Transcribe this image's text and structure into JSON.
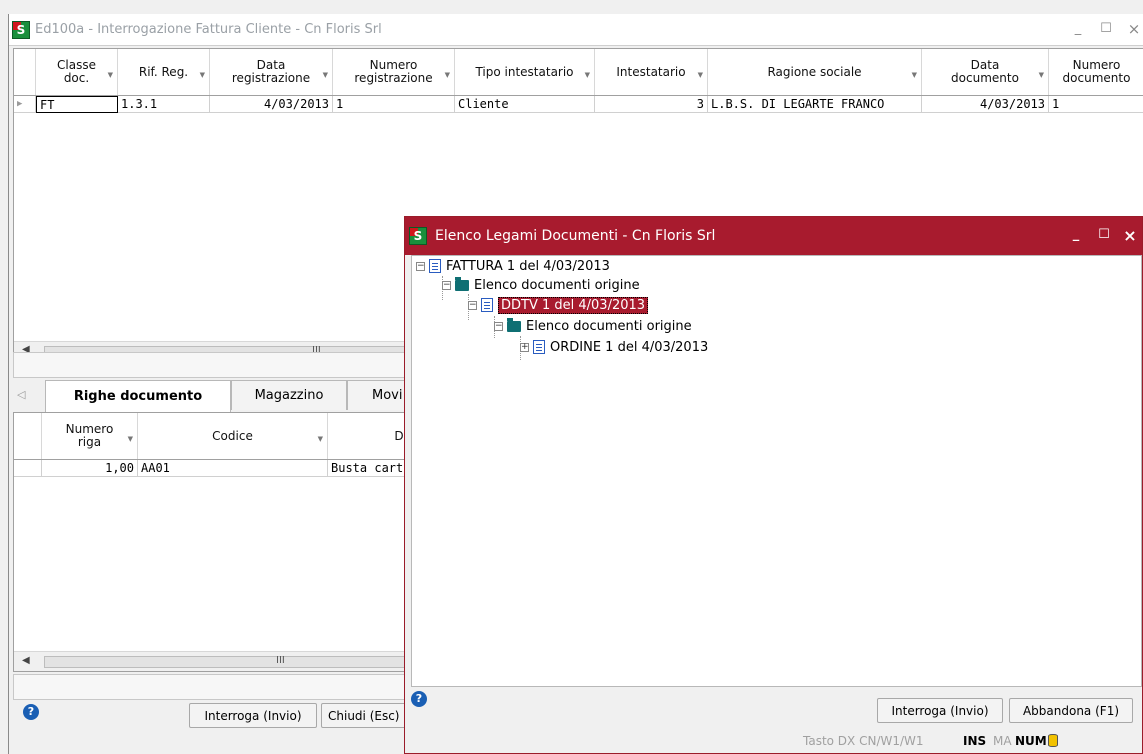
{
  "main_window": {
    "title": "Ed100a - Interrogazione Fattura Cliente - Cn Floris Srl",
    "logo_letter": "S",
    "minimize": "_",
    "maximize": "☐",
    "close": "×"
  },
  "documents_grid": {
    "columns": [
      "Classe doc.",
      "Rif. Reg.",
      "Data registrazione",
      "Numero registrazione",
      "Tipo intestatario",
      "Intestatario",
      "Ragione sociale",
      "Data documento",
      "Numero documento"
    ],
    "row": {
      "classe_doc": "FT",
      "rif_reg": "1.3.1",
      "data_registrazione": "4/03/2013",
      "numero_registrazione": "1",
      "tipo_intestatario": "Cliente",
      "intestatario": "3",
      "ragione_sociale": "L.B.S. DI LEGARTE FRANCO",
      "data_documento": "4/03/2013",
      "numero_documento": "1"
    },
    "scroll_grip": "III"
  },
  "tabs": [
    "Righe documento",
    "Magazzino",
    "Movi"
  ],
  "rows_grid": {
    "columns": [
      "Numero riga",
      "Codice",
      "De"
    ],
    "row": {
      "numero_riga": "1,00",
      "codice": "AA01",
      "descrizione": "Busta carta"
    },
    "scroll_grip": "III"
  },
  "main_buttons": {
    "query": "Interroga (Invio)",
    "close": "Chiudi (Esc)"
  },
  "dialog": {
    "title": "Elenco Legami Documenti - Cn Floris Srl",
    "logo_letter": "S",
    "minimize": "_",
    "maximize": "☐",
    "close": "×",
    "tree": {
      "root": "FATTURA 1 del  4/03/2013",
      "origin1": "Elenco documenti origine",
      "ddt": "DDTV 1 del  4/03/2013",
      "origin2": "Elenco documenti origine",
      "order": "ORDINE 1 del  4/03/2013"
    },
    "buttons": {
      "query": "Interroga (Invio)",
      "abort": "Abbandona (F1)"
    }
  },
  "statusbar": {
    "tasto": "Tasto DX  CN/W1/W1",
    "ins": "INS",
    "ma": "MA",
    "num": "NUM"
  },
  "help_symbol": "?",
  "colors": {
    "dialog_title": "#a81b2e",
    "selection": "#a81b2e",
    "folder": "#0f6f73",
    "doc_icon": "#2a5cc0"
  }
}
